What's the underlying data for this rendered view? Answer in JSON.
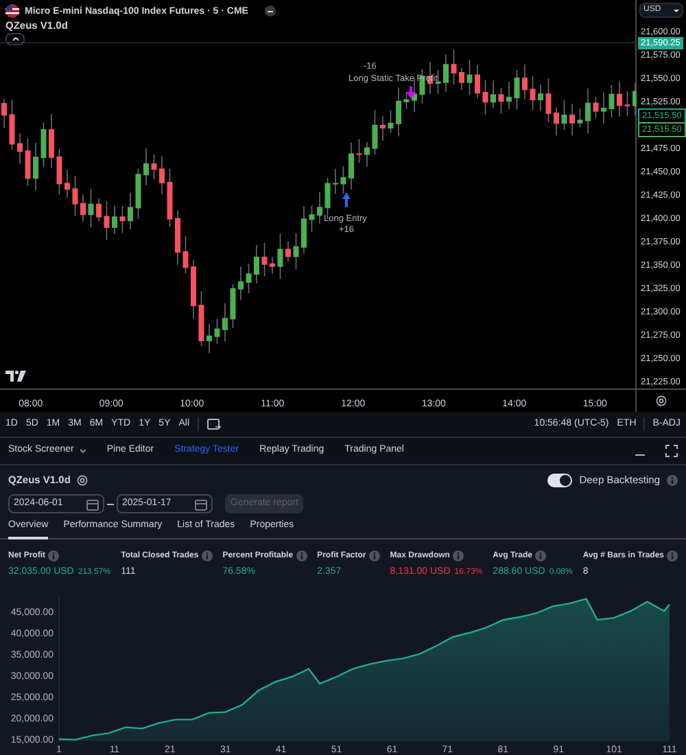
{
  "header": {
    "symbol": "Micro E-mini Nasdaq-100 Index Futures · 5 · CME",
    "indicator": "QZeus V1.0d",
    "currency": "USD"
  },
  "price_ticks": [
    "21,600.00",
    "21,575.00",
    "21,550.00",
    "21,525.00",
    "21,475.00",
    "21,450.00",
    "21,425.00",
    "21,400.00",
    "21,375.00",
    "21,350.00",
    "21,325.00",
    "21,300.00",
    "21,275.00",
    "21,250.00",
    "21,225.00"
  ],
  "price_badges": [
    {
      "label": "21,590.25",
      "kind": "last"
    },
    {
      "label": "21,515.50",
      "kind": "position"
    },
    {
      "label": "21,515.50",
      "kind": "order"
    }
  ],
  "chart_labels": [
    {
      "text": "-16",
      "kind": "exit_qty"
    },
    {
      "text": "Long Static Take Profit",
      "kind": "exit"
    },
    {
      "text": "Long Entry",
      "kind": "entry"
    },
    {
      "text": "+16",
      "kind": "entry_qty"
    }
  ],
  "time_ticks": [
    "08:00",
    "09:00",
    "10:00",
    "11:00",
    "12:00",
    "13:00",
    "14:00",
    "15:00"
  ],
  "ranges": [
    "1D",
    "5D",
    "1M",
    "3M",
    "6M",
    "YTD",
    "1Y",
    "5Y",
    "All"
  ],
  "status": {
    "time": "10:56:48 (UTC-5)",
    "session": "ETH",
    "adjust": "B-ADJ"
  },
  "bottom_tabs": [
    {
      "label": "Stock Screener",
      "dropdown": true,
      "selected": false
    },
    {
      "label": "Pine Editor",
      "dropdown": false,
      "selected": false
    },
    {
      "label": "Strategy Tester",
      "dropdown": false,
      "selected": true
    },
    {
      "label": "Replay Trading",
      "dropdown": false,
      "selected": false
    },
    {
      "label": "Trading Panel",
      "dropdown": false,
      "selected": false
    }
  ],
  "strategy": {
    "name": "QZeus V1.0d",
    "deep_backtesting": {
      "label": "Deep Backtesting",
      "on": true
    },
    "start_date": "2024-06-01",
    "end_date": "2025-01-17",
    "generate": {
      "label": "Generate report",
      "disabled": true
    }
  },
  "report_tabs": [
    {
      "label": "Overview",
      "selected": true
    },
    {
      "label": "Performance Summary",
      "selected": false
    },
    {
      "label": "List of Trades",
      "selected": false
    },
    {
      "label": "Properties",
      "selected": false
    }
  ],
  "metrics": [
    {
      "label": "Net Profit",
      "value": "32,035.00 USD",
      "change": "213.57%",
      "color": "#22ab94"
    },
    {
      "label": "Total Closed Trades",
      "value": "111",
      "color": "#d1d4dc"
    },
    {
      "label": "Percent Profitable",
      "value": "76.58%",
      "color": "#22ab94"
    },
    {
      "label": "Profit Factor",
      "value": "2.357",
      "color": "#22ab94"
    },
    {
      "label": "Max Drawdown",
      "value": "8,131.00 USD",
      "change": "16.73%",
      "color": "#f23645"
    },
    {
      "label": "Avg Trade",
      "value": "288.60 USD",
      "change": "0.08%",
      "color": "#22ab94"
    },
    {
      "label": "Avg # Bars in Trades",
      "value": "8",
      "color": "#d1d4dc"
    }
  ],
  "equity": {
    "chart_data": {
      "type": "area",
      "x": [
        1,
        4,
        7,
        10,
        13,
        16,
        19,
        22,
        25,
        28,
        31,
        34,
        37,
        40,
        43,
        46,
        48,
        51,
        54,
        57,
        60,
        63,
        66,
        69,
        72,
        75,
        78,
        81,
        84,
        87,
        90,
        93,
        96,
        98,
        101,
        104,
        107,
        110,
        111
      ],
      "series": [
        {
          "color": "#22ab94",
          "values": [
            15000,
            14900,
            15850,
            16400,
            17800,
            17500,
            18800,
            19600,
            19600,
            21200,
            21400,
            23100,
            26500,
            28500,
            29700,
            31600,
            28100,
            29700,
            31600,
            32700,
            33500,
            34000,
            35100,
            37000,
            39100,
            40100,
            41300,
            43100,
            43800,
            44700,
            46300,
            47000,
            48100,
            43100,
            43600,
            45200,
            47400,
            45200,
            46800
          ]
        }
      ],
      "xlim": [
        1,
        111
      ],
      "ylim": [
        14500,
        48800
      ],
      "xticks": [
        1,
        11,
        21,
        31,
        41,
        51,
        61,
        71,
        81,
        91,
        101,
        111
      ],
      "yticks": [
        {
          "value": 15000,
          "label": "15,000.00"
        },
        {
          "value": 20000,
          "label": "20,000.00"
        },
        {
          "value": 25000,
          "label": "25,000.00"
        },
        {
          "value": 30000,
          "label": "30,000.00"
        },
        {
          "value": 35000,
          "label": "35,000.00"
        },
        {
          "value": 40000,
          "label": "40,000.00"
        },
        {
          "value": 45000,
          "label": "45,000.00"
        }
      ]
    }
  }
}
